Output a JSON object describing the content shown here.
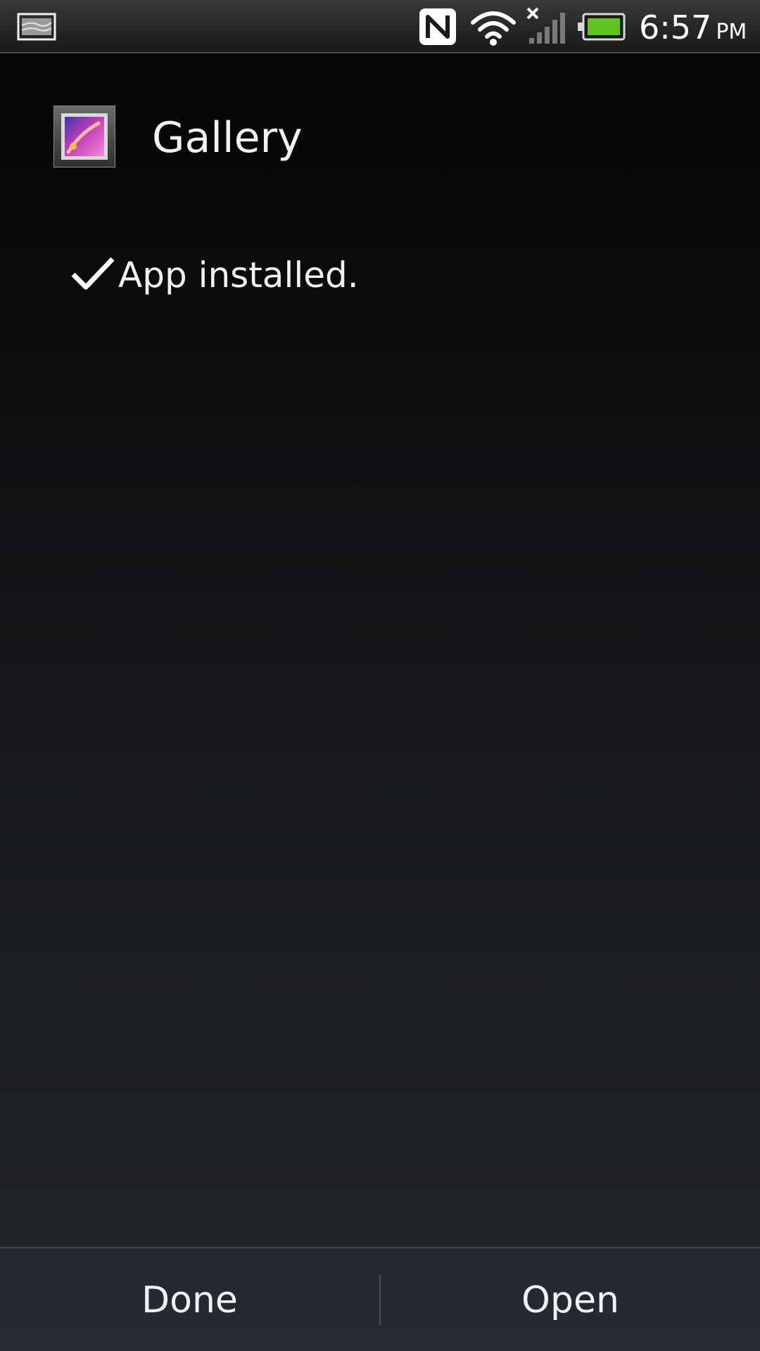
{
  "status_bar": {
    "time": "6:57",
    "ampm": "PM",
    "icons": [
      "gallery-notification-icon",
      "nfc-icon",
      "wifi-icon",
      "cell-signal-icon",
      "battery-icon"
    ],
    "battery_color": "#5fc61d"
  },
  "app": {
    "title": "Gallery",
    "icon": "gallery-app-icon"
  },
  "install": {
    "status_icon": "checkmark-icon",
    "message": "App installed."
  },
  "buttons": {
    "done_label": "Done",
    "open_label": "Open"
  }
}
